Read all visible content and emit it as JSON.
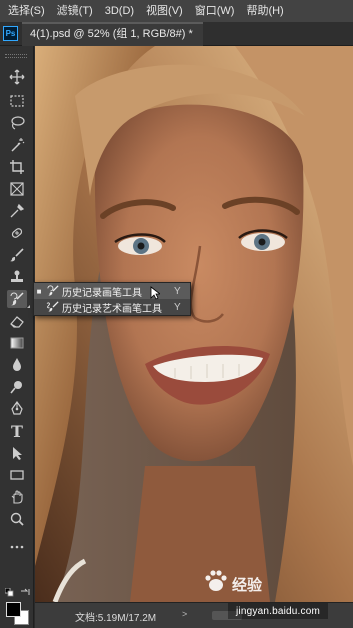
{
  "menubar": {
    "items": [
      {
        "label": "选择(S)"
      },
      {
        "label": "滤镜(T)"
      },
      {
        "label": "3D(D)"
      },
      {
        "label": "视图(V)"
      },
      {
        "label": "窗口(W)"
      },
      {
        "label": "帮助(H)"
      }
    ]
  },
  "app": {
    "logo_text": "Ps"
  },
  "document_tab": {
    "title": "4(1).psd @ 52% (组 1, RGB/8#) *"
  },
  "tool_flyout": {
    "items": [
      {
        "label": "历史记录画笔工具",
        "shortcut": "Y",
        "selected": true,
        "icon": "history-brush-icon"
      },
      {
        "label": "历史记录艺术画笔工具",
        "shortcut": "Y",
        "selected": false,
        "icon": "art-history-brush-icon"
      }
    ]
  },
  "toolbar": {
    "tools": [
      "move-icon",
      "marquee-icon",
      "lasso-icon",
      "quick-select-icon",
      "crop-icon",
      "frame-icon",
      "eyedropper-icon",
      "healing-brush-icon",
      "brush-icon",
      "clone-stamp-icon",
      "history-brush-icon",
      "eraser-icon",
      "gradient-icon",
      "blur-icon",
      "dodge-icon",
      "pen-icon",
      "type-icon",
      "path-select-icon",
      "rectangle-icon",
      "hand-icon",
      "zoom-icon",
      "more-tools-icon"
    ],
    "type_glyph": "T",
    "foreground_color": "#000000",
    "background_color": "#ffffff"
  },
  "statusbar": {
    "doc_info": "文档:5.19M/17.2M",
    "arrow": ">"
  },
  "watermark": {
    "brand": "经验",
    "url": "jingyan.baidu.com"
  }
}
